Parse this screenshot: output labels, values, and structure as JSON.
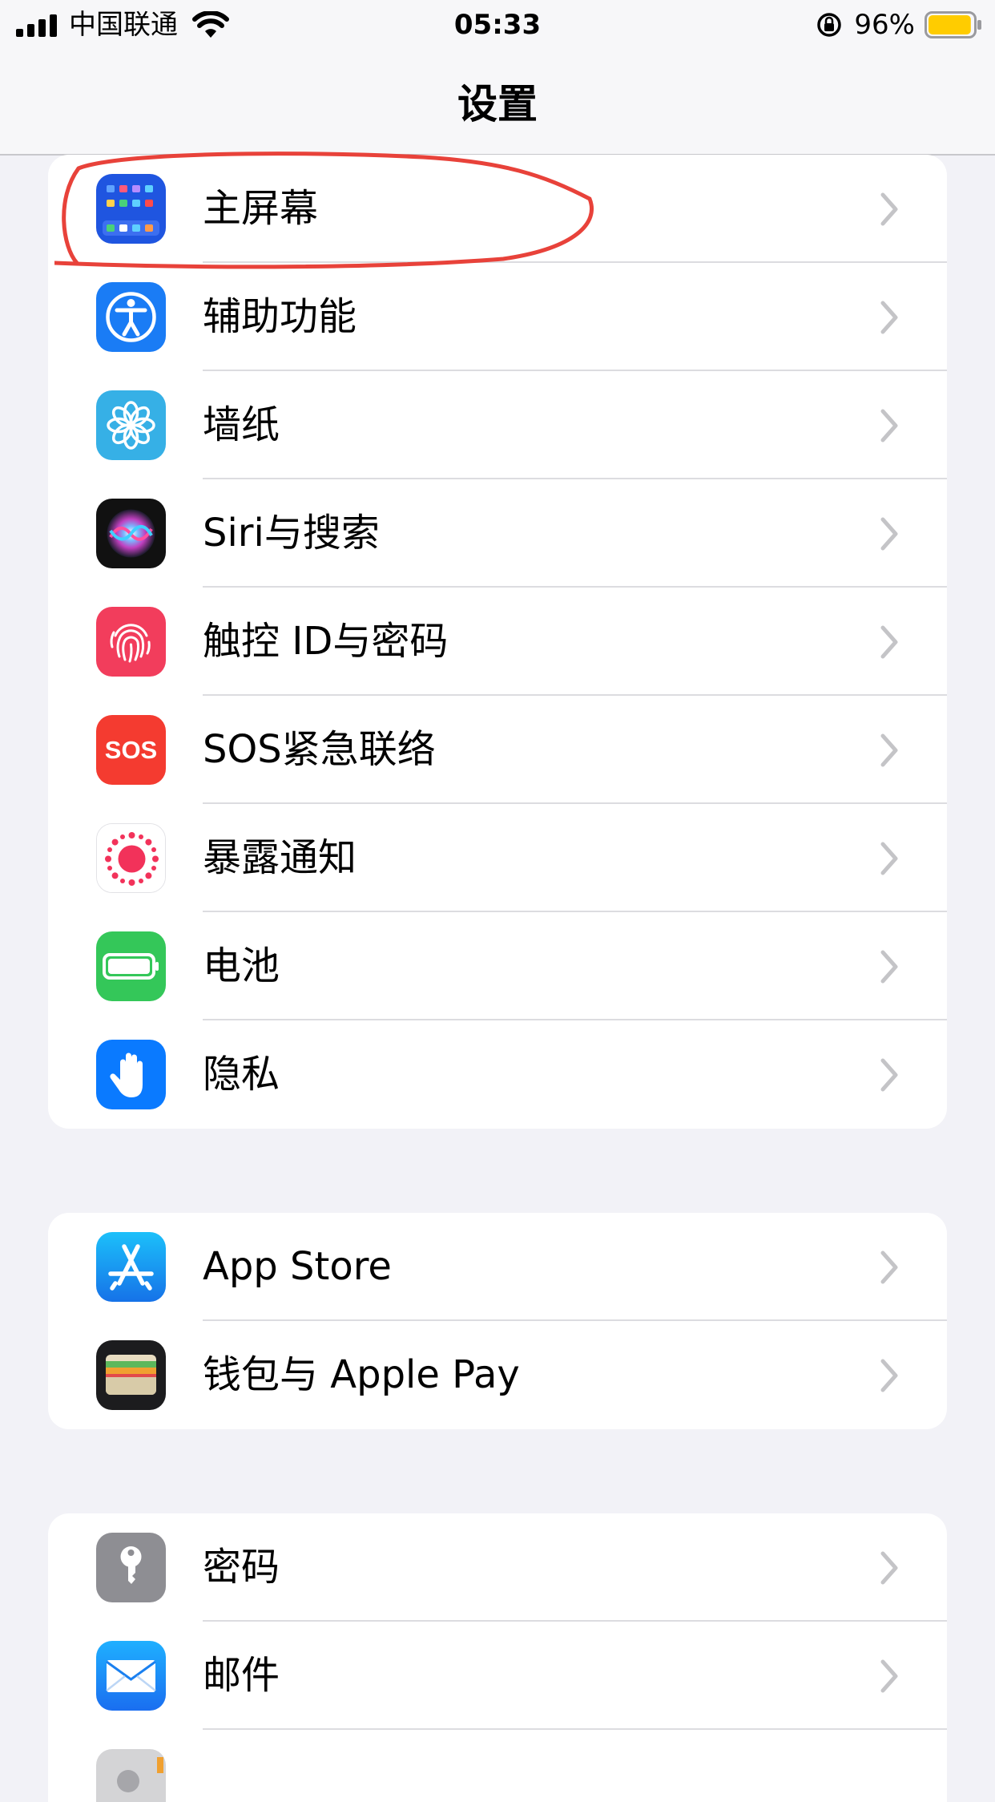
{
  "status_bar": {
    "carrier": "中国联通",
    "time": "05:33",
    "battery_percent": "96%",
    "battery_level": 0.96
  },
  "nav": {
    "title": "设置"
  },
  "groups": [
    {
      "items": [
        {
          "label": "主屏幕",
          "icon": "home-screen-icon"
        },
        {
          "label": "辅助功能",
          "icon": "accessibility-icon"
        },
        {
          "label": "墙纸",
          "icon": "wallpaper-flower-icon"
        },
        {
          "label": "Siri与搜索",
          "icon": "siri-icon"
        },
        {
          "label": "触控 ID与密码",
          "icon": "fingerprint-icon"
        },
        {
          "label": "SOS紧急联络",
          "icon": "sos-icon",
          "icon_text": "SOS"
        },
        {
          "label": "暴露通知",
          "icon": "exposure-notification-icon"
        },
        {
          "label": "电池",
          "icon": "battery-icon"
        },
        {
          "label": "隐私",
          "icon": "privacy-hand-icon"
        }
      ]
    },
    {
      "items": [
        {
          "label": "App Store",
          "icon": "app-store-icon"
        },
        {
          "label": "钱包与 Apple Pay",
          "icon": "wallet-icon"
        }
      ]
    },
    {
      "items": [
        {
          "label": "密码",
          "icon": "key-icon"
        },
        {
          "label": "邮件",
          "icon": "mail-icon"
        },
        {
          "label": "",
          "icon": "contacts-icon"
        }
      ]
    }
  ],
  "colors": {
    "background": "#f2f2f7",
    "card": "#ffffff",
    "chevron": "#c4c4c7",
    "annotation": "#e8423a"
  }
}
